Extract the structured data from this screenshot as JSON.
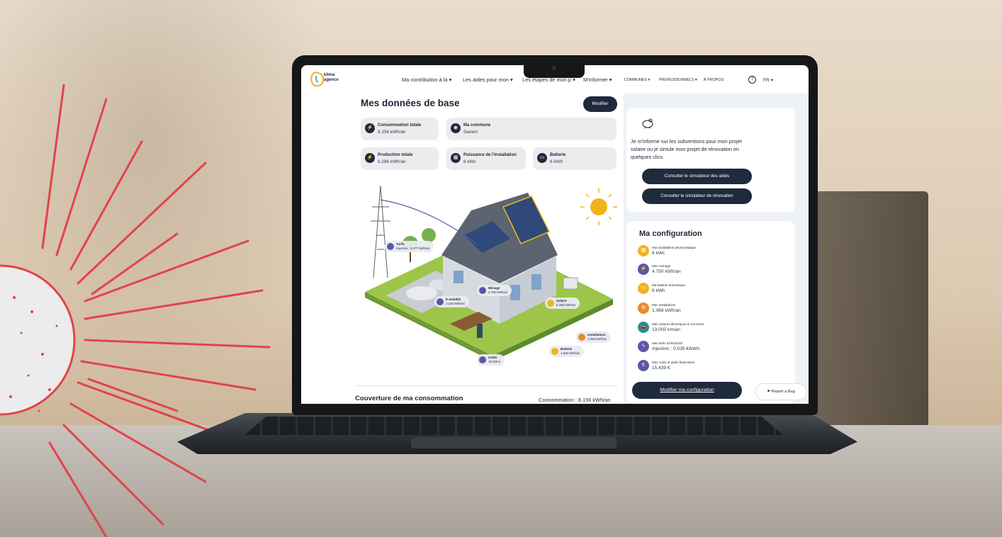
{
  "colors": {
    "brand_dark": "#1f2a3c",
    "accent_purple": "#5e56a6",
    "accent_yellow": "#f3b21b",
    "accent_orange": "#e98a2b",
    "accent_teal": "#2f8f8a",
    "sunburst_red": "#e2434b"
  },
  "nav": {
    "logo_line1": "klima",
    "logo_line2": "agence",
    "items": [
      "Ma contribution à la",
      "Les aides pour mon",
      "Les étapes de mon p",
      "M'informer"
    ],
    "small_items": [
      "COMMUNES",
      "PROFESSIONNELS",
      "À PROPOS"
    ],
    "help_icon": "?",
    "language": "FR"
  },
  "main": {
    "title": "Mes données de base",
    "modify_label": "Modifier",
    "cards": [
      {
        "label": "Consommation totale",
        "value": "8.156 kWh/an",
        "icon": "meter-icon"
      },
      {
        "label": "Ma commune",
        "value": "Sanem",
        "icon": "location-pin-icon"
      },
      {
        "label": "Production totale",
        "value": "6.286 kWh/an",
        "icon": "production-icon"
      },
      {
        "label": "Puissance de l'installation",
        "value": "6 kWc",
        "icon": "solar-panel-icon"
      },
      {
        "label": "Batterie",
        "value": "6 kWh",
        "icon": "battery-icon"
      }
    ],
    "illustration_tags": [
      {
        "label": "Tarifs",
        "value": "Injection : 2.477 kWh/an"
      },
      {
        "label": "E-mobilité",
        "value": "2.240 kWh/an"
      },
      {
        "label": "Ménage",
        "value": "4.750 kWh/an"
      },
      {
        "label": "Solaire",
        "value": "6.286 kWh/an"
      },
      {
        "label": "Installations",
        "value": "1.066 kWh/an"
      },
      {
        "label": "Batterie",
        "value": "1.502 kWh/an"
      },
      {
        "label": "Coûts",
        "value": "15.439 €"
      }
    ],
    "coverage_title": "Couverture de ma consommation",
    "consumption_label": "Consommation : 8.156 kWh/an"
  },
  "sidebar": {
    "info_text": "Je m'informe sur les subventions pour mon projet solaire ou je simule mon projet de rénovation en quelques clics.",
    "btn_aids": "Consulter le simulateur des aides",
    "btn_renovation": "Consulter le simulateur de rénovation",
    "config_title": "Ma configuration",
    "config_items": [
      {
        "label": "Mon installation photovoltaïque",
        "value": "6 kWc",
        "color": "#f3b21b",
        "icon": "solar-panel-icon"
      },
      {
        "label": "Mon ménage",
        "value": "4.750 kWh/an",
        "color": "#5e56a6",
        "icon": "house-meter-icon"
      },
      {
        "label": "Ma batterie domestique",
        "value": "6 kWh",
        "color": "#f3b21b",
        "icon": "battery-icon"
      },
      {
        "label": "Mes installations",
        "value": "1.066 kWh/an",
        "color": "#e98a2b",
        "icon": "appliance-icon"
      },
      {
        "label": "Mes voitures électriques et ma borne",
        "value": "13.000 km/an",
        "color": "#2f8f8a",
        "icon": "car-icon"
      },
      {
        "label": "Mes tarifs d'électricité",
        "value": "Injection : 0,035 €/kWh",
        "color": "#5e56a6",
        "icon": "lightning-icon"
      },
      {
        "label": "Mes coûts et aides financières",
        "value": "15.439 €",
        "color": "#5e56a6",
        "icon": "coins-icon"
      }
    ],
    "config_button": "Modifier ma configuration",
    "report_bug": "Report a Bug"
  }
}
